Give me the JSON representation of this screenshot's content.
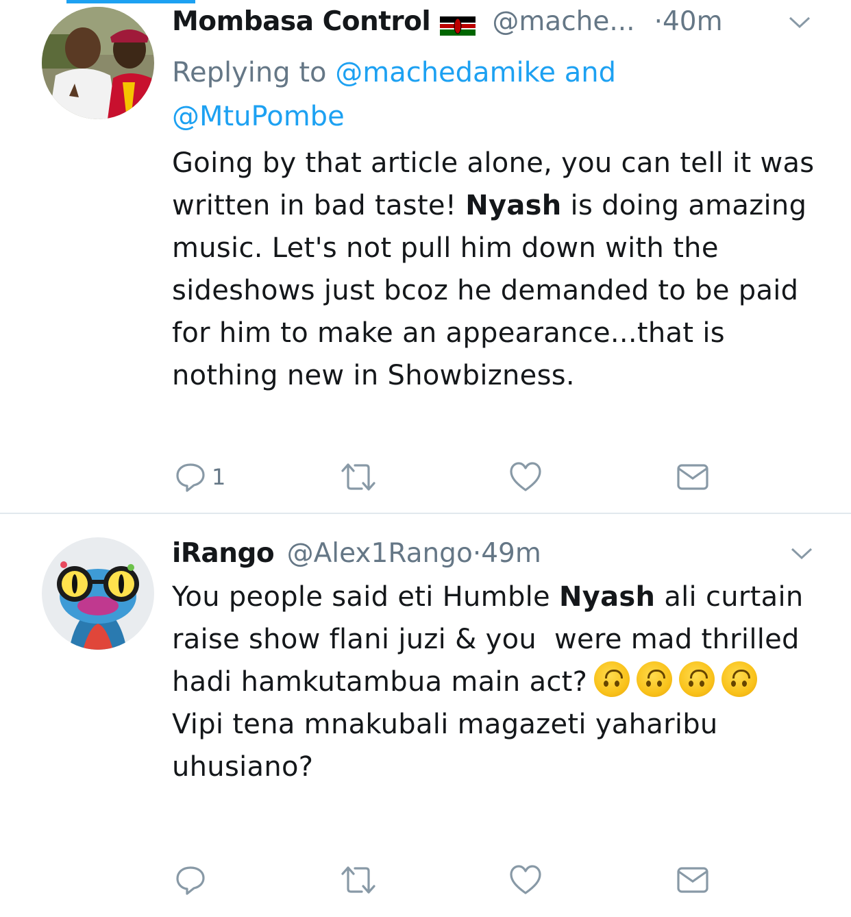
{
  "colors": {
    "accent": "#1da1f2",
    "muted": "#657786",
    "text": "#14171a"
  },
  "tweets": [
    {
      "display_name": "Mombasa Control",
      "flag_icon": "kenya-flag-icon",
      "handle": "@mache...",
      "dot": "·",
      "time": "40m",
      "replying_label": "Replying to",
      "replying_to_1": "@machedamike and",
      "replying_to_2": "@MtuPombe",
      "body_1": "Going by that article alone, you can tell it was written in bad taste! ",
      "body_bold": "Nyash",
      "body_2": " is doing amazing music. Let's not pull him down with the sideshows just bcoz he demanded to be paid for him to make an appearance...that is nothing new in Showbizness.",
      "reply_count": "1"
    },
    {
      "display_name": "iRango",
      "handle": "@Alex1Rango",
      "dot": "·",
      "time": "49m",
      "body_1": "You people said eti Humble ",
      "body_bold": "Nyash",
      "body_2": " ali curtain raise show flani juzi & you  were mad thrilled hadi hamkutambua main act?",
      "emoji": "upside-down-face-icon",
      "body_3": "Vipi tena mnakubali magazeti yaharibu uhusiano?",
      "reply_count": ""
    }
  ]
}
